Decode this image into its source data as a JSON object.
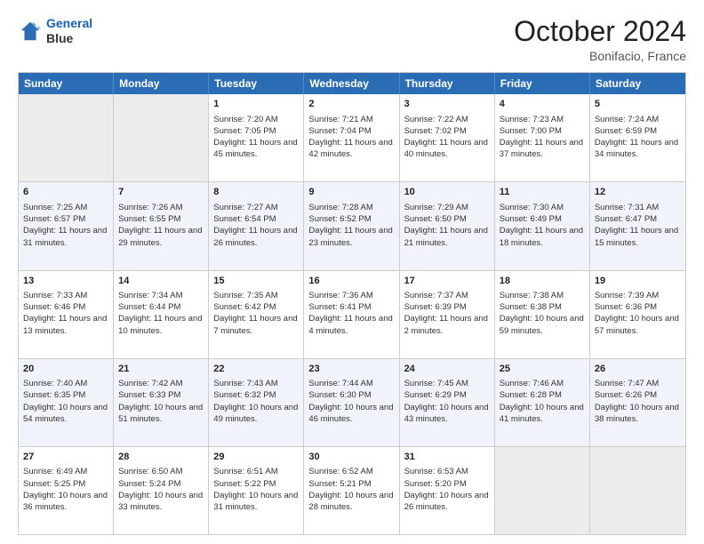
{
  "header": {
    "logo_line1": "General",
    "logo_line2": "Blue",
    "month_title": "October 2024",
    "location": "Bonifacio, France"
  },
  "weekdays": [
    "Sunday",
    "Monday",
    "Tuesday",
    "Wednesday",
    "Thursday",
    "Friday",
    "Saturday"
  ],
  "rows": [
    [
      {
        "day": "",
        "content": "",
        "empty": true
      },
      {
        "day": "",
        "content": "",
        "empty": true
      },
      {
        "day": "1",
        "content": "Sunrise: 7:20 AM\nSunset: 7:05 PM\nDaylight: 11 hours and 45 minutes.",
        "empty": false
      },
      {
        "day": "2",
        "content": "Sunrise: 7:21 AM\nSunset: 7:04 PM\nDaylight: 11 hours and 42 minutes.",
        "empty": false
      },
      {
        "day": "3",
        "content": "Sunrise: 7:22 AM\nSunset: 7:02 PM\nDaylight: 11 hours and 40 minutes.",
        "empty": false
      },
      {
        "day": "4",
        "content": "Sunrise: 7:23 AM\nSunset: 7:00 PM\nDaylight: 11 hours and 37 minutes.",
        "empty": false
      },
      {
        "day": "5",
        "content": "Sunrise: 7:24 AM\nSunset: 6:59 PM\nDaylight: 11 hours and 34 minutes.",
        "empty": false
      }
    ],
    [
      {
        "day": "6",
        "content": "Sunrise: 7:25 AM\nSunset: 6:57 PM\nDaylight: 11 hours and 31 minutes.",
        "empty": false
      },
      {
        "day": "7",
        "content": "Sunrise: 7:26 AM\nSunset: 6:55 PM\nDaylight: 11 hours and 29 minutes.",
        "empty": false
      },
      {
        "day": "8",
        "content": "Sunrise: 7:27 AM\nSunset: 6:54 PM\nDaylight: 11 hours and 26 minutes.",
        "empty": false
      },
      {
        "day": "9",
        "content": "Sunrise: 7:28 AM\nSunset: 6:52 PM\nDaylight: 11 hours and 23 minutes.",
        "empty": false
      },
      {
        "day": "10",
        "content": "Sunrise: 7:29 AM\nSunset: 6:50 PM\nDaylight: 11 hours and 21 minutes.",
        "empty": false
      },
      {
        "day": "11",
        "content": "Sunrise: 7:30 AM\nSunset: 6:49 PM\nDaylight: 11 hours and 18 minutes.",
        "empty": false
      },
      {
        "day": "12",
        "content": "Sunrise: 7:31 AM\nSunset: 6:47 PM\nDaylight: 11 hours and 15 minutes.",
        "empty": false
      }
    ],
    [
      {
        "day": "13",
        "content": "Sunrise: 7:33 AM\nSunset: 6:46 PM\nDaylight: 11 hours and 13 minutes.",
        "empty": false
      },
      {
        "day": "14",
        "content": "Sunrise: 7:34 AM\nSunset: 6:44 PM\nDaylight: 11 hours and 10 minutes.",
        "empty": false
      },
      {
        "day": "15",
        "content": "Sunrise: 7:35 AM\nSunset: 6:42 PM\nDaylight: 11 hours and 7 minutes.",
        "empty": false
      },
      {
        "day": "16",
        "content": "Sunrise: 7:36 AM\nSunset: 6:41 PM\nDaylight: 11 hours and 4 minutes.",
        "empty": false
      },
      {
        "day": "17",
        "content": "Sunrise: 7:37 AM\nSunset: 6:39 PM\nDaylight: 11 hours and 2 minutes.",
        "empty": false
      },
      {
        "day": "18",
        "content": "Sunrise: 7:38 AM\nSunset: 6:38 PM\nDaylight: 10 hours and 59 minutes.",
        "empty": false
      },
      {
        "day": "19",
        "content": "Sunrise: 7:39 AM\nSunset: 6:36 PM\nDaylight: 10 hours and 57 minutes.",
        "empty": false
      }
    ],
    [
      {
        "day": "20",
        "content": "Sunrise: 7:40 AM\nSunset: 6:35 PM\nDaylight: 10 hours and 54 minutes.",
        "empty": false
      },
      {
        "day": "21",
        "content": "Sunrise: 7:42 AM\nSunset: 6:33 PM\nDaylight: 10 hours and 51 minutes.",
        "empty": false
      },
      {
        "day": "22",
        "content": "Sunrise: 7:43 AM\nSunset: 6:32 PM\nDaylight: 10 hours and 49 minutes.",
        "empty": false
      },
      {
        "day": "23",
        "content": "Sunrise: 7:44 AM\nSunset: 6:30 PM\nDaylight: 10 hours and 46 minutes.",
        "empty": false
      },
      {
        "day": "24",
        "content": "Sunrise: 7:45 AM\nSunset: 6:29 PM\nDaylight: 10 hours and 43 minutes.",
        "empty": false
      },
      {
        "day": "25",
        "content": "Sunrise: 7:46 AM\nSunset: 6:28 PM\nDaylight: 10 hours and 41 minutes.",
        "empty": false
      },
      {
        "day": "26",
        "content": "Sunrise: 7:47 AM\nSunset: 6:26 PM\nDaylight: 10 hours and 38 minutes.",
        "empty": false
      }
    ],
    [
      {
        "day": "27",
        "content": "Sunrise: 6:49 AM\nSunset: 5:25 PM\nDaylight: 10 hours and 36 minutes.",
        "empty": false
      },
      {
        "day": "28",
        "content": "Sunrise: 6:50 AM\nSunset: 5:24 PM\nDaylight: 10 hours and 33 minutes.",
        "empty": false
      },
      {
        "day": "29",
        "content": "Sunrise: 6:51 AM\nSunset: 5:22 PM\nDaylight: 10 hours and 31 minutes.",
        "empty": false
      },
      {
        "day": "30",
        "content": "Sunrise: 6:52 AM\nSunset: 5:21 PM\nDaylight: 10 hours and 28 minutes.",
        "empty": false
      },
      {
        "day": "31",
        "content": "Sunrise: 6:53 AM\nSunset: 5:20 PM\nDaylight: 10 hours and 26 minutes.",
        "empty": false
      },
      {
        "day": "",
        "content": "",
        "empty": true
      },
      {
        "day": "",
        "content": "",
        "empty": true
      }
    ]
  ]
}
